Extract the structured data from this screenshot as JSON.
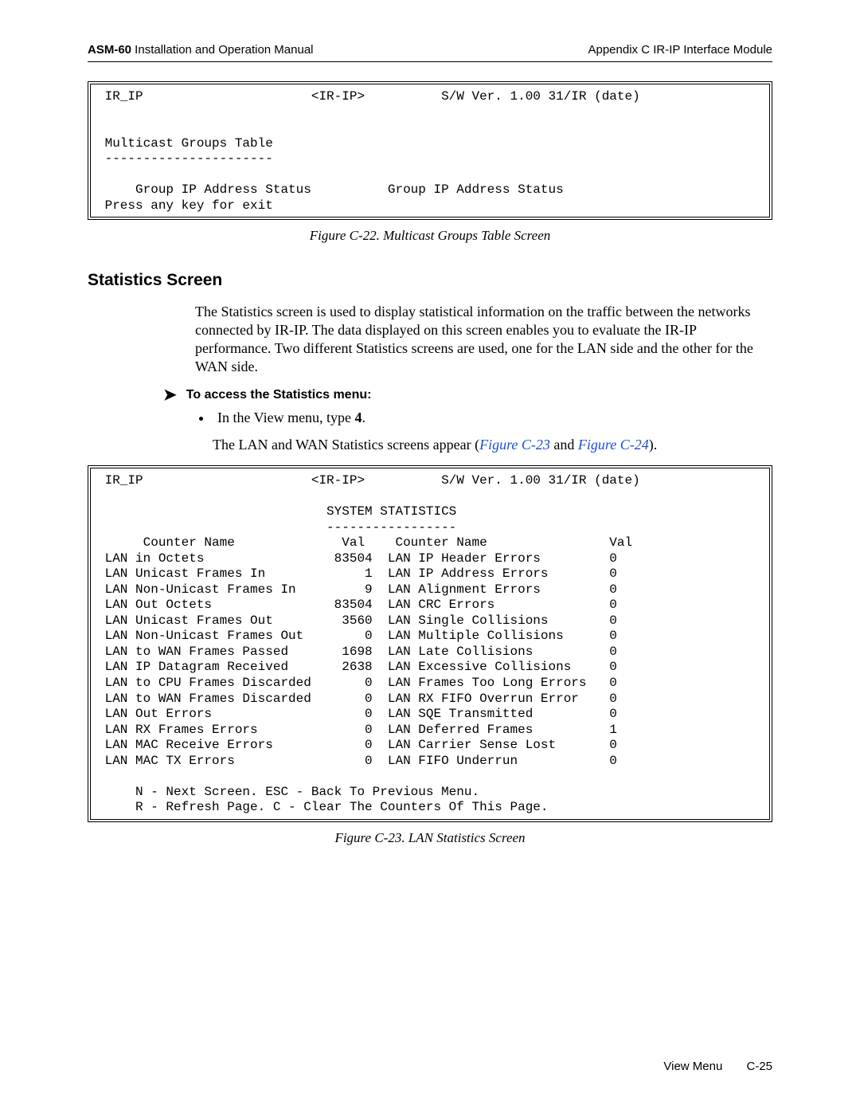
{
  "header": {
    "left_bold": "ASM-60",
    "left_rest": " Installation and Operation Manual",
    "right": "Appendix C  IR-IP Interface Module"
  },
  "term1": {
    "line1a": " IR_IP",
    "line1b": "<IR-IP>",
    "line1c": "S/W Ver. 1.00 31/IR (date)",
    "blank": "",
    "title": " Multicast Groups Table",
    "rule": " ----------------------",
    "cols": "     Group IP Address Status          Group IP Address Status",
    "exit": " Press any key for exit"
  },
  "cap1": "Figure C-22.  Multicast Groups Table Screen",
  "section_heading": "Statistics Screen",
  "para1": "The Statistics screen is used to display statistical information on the traffic between the networks connected by IR-IP. The data displayed on this screen enables you to evaluate the IR-IP performance. Two different Statistics screens are used, one for the LAN side and the other for the WAN side.",
  "proc_heading": "To access the Statistics menu:",
  "bullet_pre": "In the View menu, type ",
  "bullet_bold": "4",
  "bullet_post": ".",
  "para2_pre": "The LAN and WAN Statistics screens appear (",
  "figref1": "Figure C-23",
  "para2_mid": " and ",
  "figref2": "Figure C-24",
  "para2_post": ").",
  "term2": {
    "hline_a": " IR_IP",
    "hline_b": "<IR-IP>",
    "hline_c": "S/W Ver. 1.00 31/IR (date)",
    "title": "                              SYSTEM STATISTICS",
    "rule": "                              -----------------",
    "cols": "      Counter Name              Val    Counter Name                Val",
    "rows": [
      " LAN in Octets                 83504  LAN IP Header Errors         0",
      " LAN Unicast Frames In             1  LAN IP Address Errors        0",
      " LAN Non-Unicast Frames In         9  LAN Alignment Errors         0",
      " LAN Out Octets                83504  LAN CRC Errors               0",
      " LAN Unicast Frames Out         3560  LAN Single Collisions        0",
      " LAN Non-Unicast Frames Out        0  LAN Multiple Collisions      0",
      " LAN to WAN Frames Passed       1698  LAN Late Collisions          0",
      " LAN IP Datagram Received       2638  LAN Excessive Collisions     0",
      " LAN to CPU Frames Discarded       0  LAN Frames Too Long Errors   0",
      " LAN to WAN Frames Discarded       0  LAN RX FIFO Overrun Error    0",
      " LAN Out Errors                    0  LAN SQE Transmitted          0",
      " LAN RX Frames Errors              0  LAN Deferred Frames          1",
      " LAN MAC Receive Errors            0  LAN Carrier Sense Lost       0",
      " LAN MAC TX Errors                 0  LAN FIFO Underrun            0"
    ],
    "nav1": "     N - Next Screen. ESC - Back To Previous Menu.",
    "nav2": "     R - Refresh Page. C - Clear The Counters Of This Page."
  },
  "cap2": "Figure C-23.  LAN Statistics Screen",
  "footer": {
    "label": "View Menu",
    "page": "C-25"
  }
}
